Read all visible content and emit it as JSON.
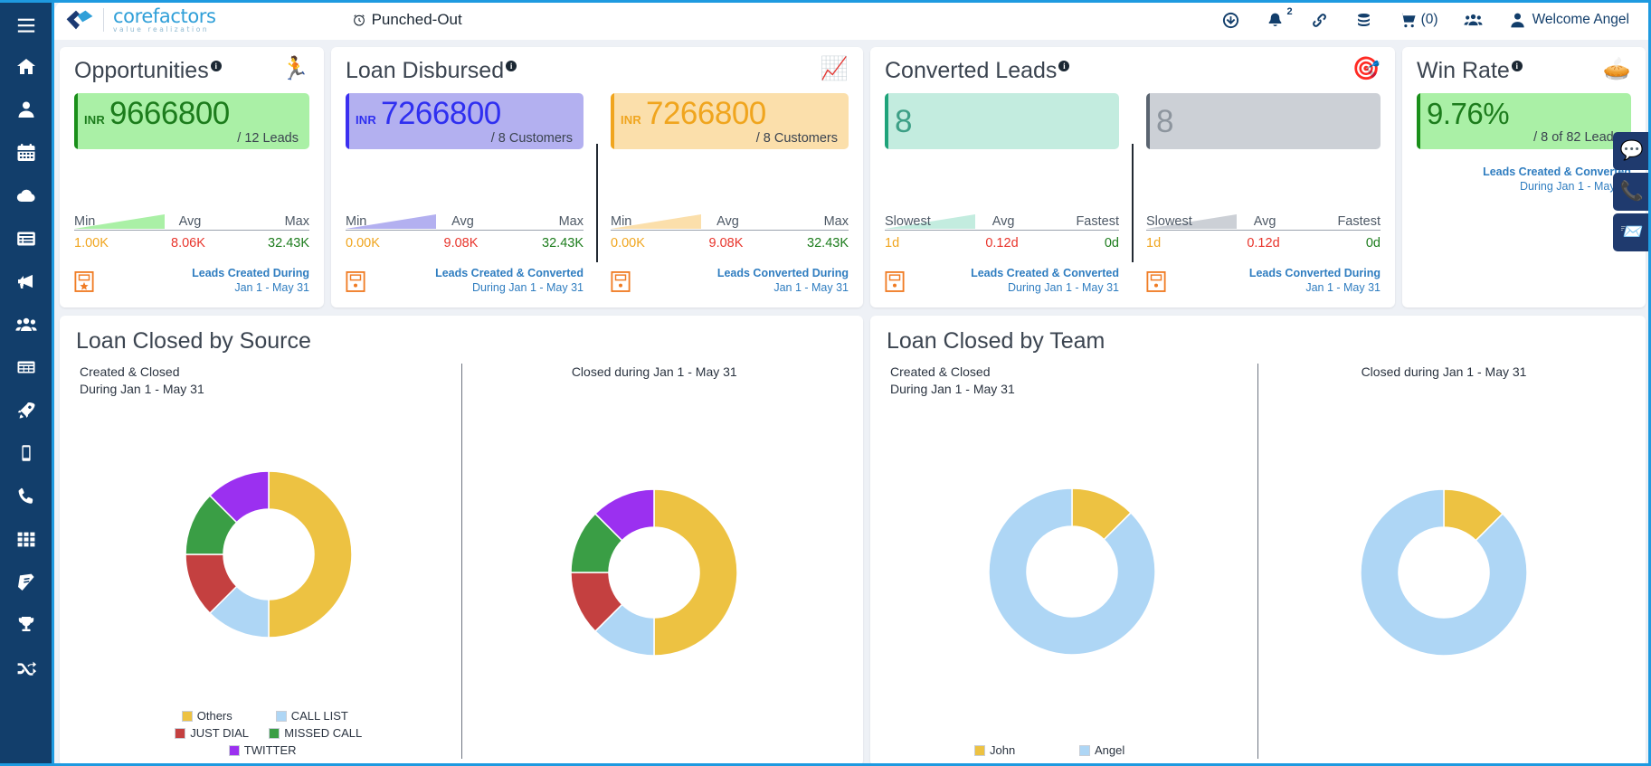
{
  "header": {
    "logo_name": "corefactors",
    "logo_tagline": "value realization",
    "punched_status": "Punched-Out",
    "menu_icon": "hamburger-icon",
    "actions": [
      {
        "name": "download-icon",
        "label": ""
      },
      {
        "name": "notification-bell-icon",
        "label": "",
        "badge": "2"
      },
      {
        "name": "link-icon",
        "label": ""
      },
      {
        "name": "coins-icon",
        "label": ""
      },
      {
        "name": "cart-icon",
        "label": "(0)"
      },
      {
        "name": "users-group-icon",
        "label": ""
      },
      {
        "name": "user-icon",
        "label": "Welcome Angel"
      }
    ]
  },
  "sidebar": {
    "items": [
      {
        "name": "hamburger-icon",
        "label": "Menu"
      },
      {
        "name": "home-icon",
        "label": "Home"
      },
      {
        "name": "user-icon",
        "label": "Leads"
      },
      {
        "name": "calendar-icon",
        "label": "Calendar"
      },
      {
        "name": "cloud-icon",
        "label": "Cloud"
      },
      {
        "name": "list-icon",
        "label": "Lists"
      },
      {
        "name": "megaphone-icon",
        "label": "Campaigns"
      },
      {
        "name": "users-icon",
        "label": "Teams"
      },
      {
        "name": "table-icon",
        "label": "Reports"
      },
      {
        "name": "rocket-icon",
        "label": "Launch"
      },
      {
        "name": "mobile-icon",
        "label": "Mobile"
      },
      {
        "name": "phone-icon",
        "label": "Calls"
      },
      {
        "name": "grid-apps-icon",
        "label": "Apps"
      },
      {
        "name": "book-icon",
        "label": "Knowledge"
      },
      {
        "name": "trophy-icon",
        "label": "Achievements"
      },
      {
        "name": "shuffle-icon",
        "label": "Workflows"
      }
    ]
  },
  "kpi_cards": [
    {
      "title": "Opportunities",
      "icon": "runner-emoji",
      "info": "i",
      "panels": [
        {
          "style": "green",
          "currency": "INR",
          "amount": "9666800",
          "sub": "/ 12 Leads",
          "labels": {
            "left": "Min",
            "mid": "Avg",
            "right": "Max"
          },
          "values": {
            "min": "1.00K",
            "avg": "8.06K",
            "max": "32.43K"
          },
          "footer_line1": "Leads Created During",
          "footer_line2": "Jan 1 - May 31",
          "footer_icon": "clipboard-star-icon"
        }
      ]
    },
    {
      "title": "Loan Disbursed",
      "icon": "chart-money-emoji",
      "info": "i",
      "panels": [
        {
          "style": "violet",
          "currency": "INR",
          "amount": "7266800",
          "sub": "/ 8 Customers",
          "labels": {
            "left": "Min",
            "mid": "Avg",
            "right": "Max"
          },
          "values": {
            "min": "0.00K",
            "avg": "9.08K",
            "max": "32.43K"
          },
          "footer_line1": "Leads Created & Converted",
          "footer_line2": "During Jan 1 - May 31",
          "footer_icon": "clipboard-icon"
        },
        {
          "style": "amber",
          "currency": "INR",
          "amount": "7266800",
          "sub": "/ 8 Customers",
          "labels": {
            "left": "Min",
            "mid": "Avg",
            "right": "Max"
          },
          "values": {
            "min": "0.00K",
            "avg": "9.08K",
            "max": "32.43K"
          },
          "footer_line1": "Leads Converted During",
          "footer_line2": "Jan 1 - May 31",
          "footer_icon": "clipboard-icon"
        }
      ]
    },
    {
      "title": "Converted Leads",
      "icon": "target-emoji",
      "info": "i",
      "panels": [
        {
          "style": "teal",
          "currency": "",
          "amount": "8",
          "sub": "",
          "labels": {
            "left": "Slowest",
            "mid": "Avg",
            "right": "Fastest"
          },
          "values": {
            "min": "1d",
            "avg": "0.12d",
            "max": "0d"
          },
          "footer_line1": "Leads Created & Converted",
          "footer_line2": "During Jan 1 - May 31",
          "footer_icon": "clipboard-icon"
        },
        {
          "style": "grey",
          "currency": "",
          "amount": "8",
          "sub": "",
          "labels": {
            "left": "Slowest",
            "mid": "Avg",
            "right": "Fastest"
          },
          "values": {
            "min": "1d",
            "avg": "0.12d",
            "max": "0d"
          },
          "footer_line1": "Leads Converted During",
          "footer_line2": "Jan 1 - May 31",
          "footer_icon": "clipboard-icon"
        }
      ]
    },
    {
      "title": "Win Rate",
      "icon": "pie-chart-emoji",
      "info": "i",
      "panels": [
        {
          "style": "win",
          "currency": "",
          "amount": "9.76%",
          "sub": "/ 8 of 82 Leads",
          "labels": null,
          "values": null,
          "footer_line1": "Leads Created & Converted",
          "footer_line2": "During Jan 1 - May 31",
          "footer_icon": ""
        }
      ]
    }
  ],
  "chart_data": [
    {
      "type": "pie",
      "title": "Loan Closed by Source",
      "subcharts": [
        {
          "caption_line1": "Created & Closed",
          "caption_line2": "During Jan 1 - May 31",
          "labels": [
            "Others",
            "CALL LIST",
            "JUST DIAL",
            "MISSED CALL",
            "TWITTER"
          ],
          "values": [
            50,
            12.5,
            12.5,
            12.5,
            12.5
          ],
          "colors": [
            "#edc242",
            "#aed6f5",
            "#c44040",
            "#3a9e45",
            "#9b30f0"
          ]
        },
        {
          "caption_line1": "Closed during Jan 1 - May 31",
          "caption_line2": "",
          "labels": [
            "Others",
            "CALL LIST",
            "JUST DIAL",
            "MISSED CALL",
            "TWITTER"
          ],
          "values": [
            50,
            12.5,
            12.5,
            12.5,
            12.5
          ],
          "colors": [
            "#edc242",
            "#aed6f5",
            "#c44040",
            "#3a9e45",
            "#9b30f0"
          ]
        }
      ],
      "legend": [
        {
          "label": "Others",
          "color": "#edc242"
        },
        {
          "label": "CALL LIST",
          "color": "#aed6f5"
        },
        {
          "label": "JUST DIAL",
          "color": "#c44040"
        },
        {
          "label": "MISSED CALL",
          "color": "#3a9e45"
        },
        {
          "label": "TWITTER",
          "color": "#9b30f0"
        }
      ],
      "legend_position": "bottom"
    },
    {
      "type": "pie",
      "title": "Loan Closed by Team",
      "subcharts": [
        {
          "caption_line1": "Created & Closed",
          "caption_line2": "During Jan 1 - May 31",
          "labels": [
            "John",
            "Angel"
          ],
          "values": [
            12.5,
            87.5
          ],
          "colors": [
            "#edc242",
            "#aed6f5"
          ]
        },
        {
          "caption_line1": "Closed during Jan 1 - May 31",
          "caption_line2": "",
          "labels": [
            "John",
            "Angel"
          ],
          "values": [
            12.5,
            87.5
          ],
          "colors": [
            "#edc242",
            "#aed6f5"
          ]
        }
      ],
      "legend": [
        {
          "label": "John",
          "color": "#edc242"
        },
        {
          "label": "Angel",
          "color": "#aed6f5"
        }
      ],
      "legend_position": "bottom"
    }
  ],
  "floaters": [
    {
      "name": "chat-icon",
      "glyph": "💬"
    },
    {
      "name": "phone-icon",
      "glyph": "📞"
    },
    {
      "name": "email-icon",
      "glyph": "📨"
    }
  ]
}
